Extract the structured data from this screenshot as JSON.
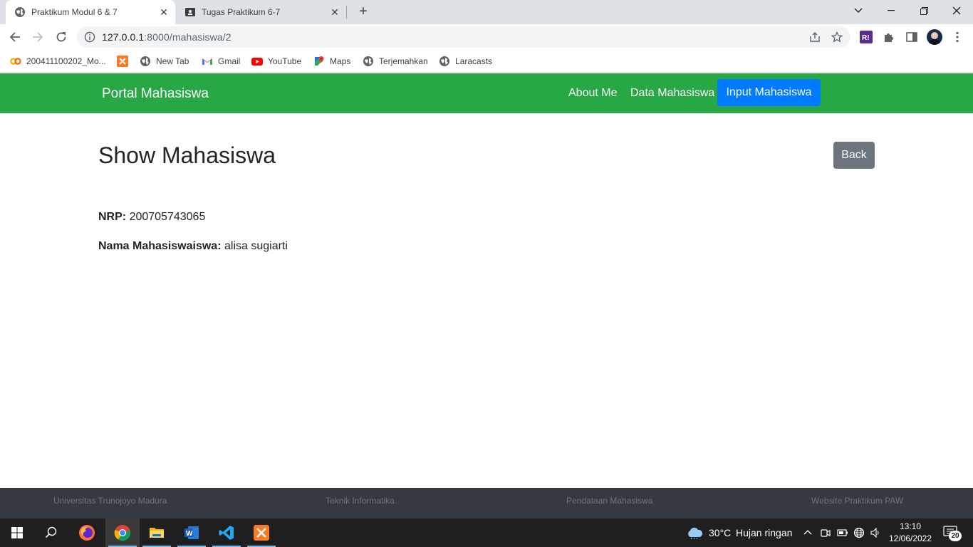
{
  "browser": {
    "tabs": [
      {
        "title": "Praktikum Modul 6 & 7",
        "icon": "globe-icon",
        "active": true
      },
      {
        "title": "Tugas Praktikum 6-7",
        "icon": "contact-card-icon",
        "active": false
      }
    ],
    "address": {
      "host": "127.0.0.1",
      "path": ":8000/mahasiswa/2"
    },
    "bookmarks": [
      {
        "label": "200411100202_Mo...",
        "icon": "colab-icon"
      },
      {
        "label": "",
        "icon": "xampp-icon"
      },
      {
        "label": "New Tab",
        "icon": "globe-icon"
      },
      {
        "label": "Gmail",
        "icon": "gmail-icon"
      },
      {
        "label": "YouTube",
        "icon": "youtube-icon"
      },
      {
        "label": "Maps",
        "icon": "maps-icon"
      },
      {
        "label": "Terjemahkan",
        "icon": "globe-icon"
      },
      {
        "label": "Laracasts",
        "icon": "globe-icon"
      }
    ]
  },
  "navbar": {
    "brand": "Portal Mahasiswa",
    "links": [
      "About Me",
      "Data Mahasiswa",
      "Input Mahasiswa"
    ],
    "color": "#28a745",
    "active_color": "#007bff"
  },
  "main": {
    "title": "Show Mahasiswa",
    "back_label": "Back",
    "fields": [
      {
        "label": "NRP:",
        "value": "200705743065"
      },
      {
        "label": "Nama Mahasiswaiswa:",
        "value": "alisa sugiarti"
      }
    ]
  },
  "footer": {
    "items": [
      "Universitas Trunojoyo Madura",
      "Teknik Informatika",
      "Pendataan Mahasiswa",
      "Website Praktikum PAW"
    ]
  },
  "taskbar": {
    "weather": {
      "temp": "30°C",
      "desc": "Hujan ringan"
    },
    "time": "13:10",
    "date": "12/06/2022",
    "notifications": "20"
  }
}
